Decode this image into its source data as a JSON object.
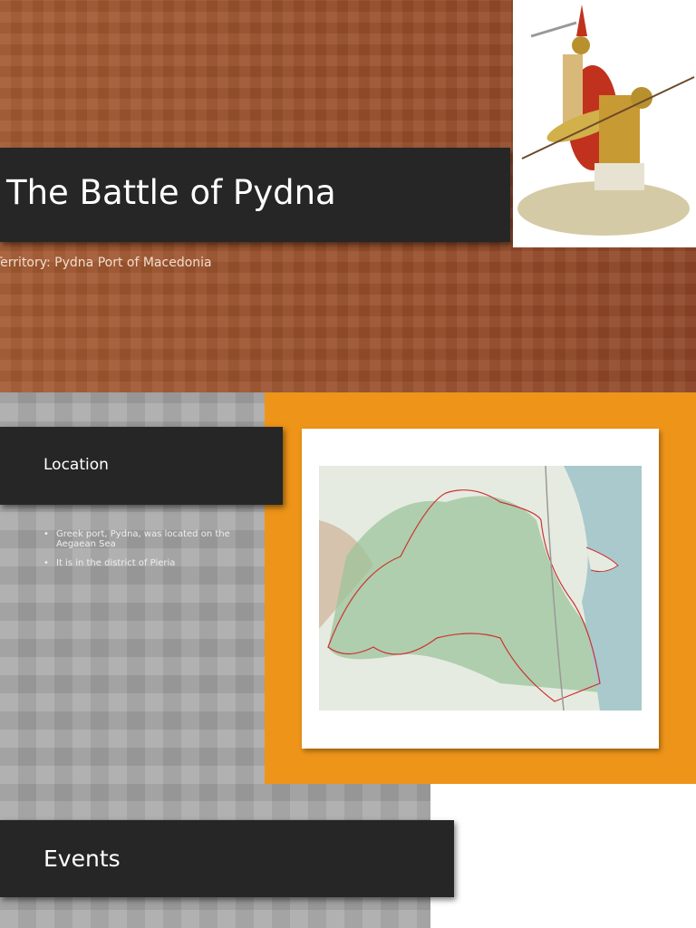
{
  "slide1": {
    "title": "The Battle of Pydna",
    "subtitle": "Territory: Pydna Port of Macedonia"
  },
  "slide2": {
    "heading": "Location",
    "bullets": [
      "Greek port, Pydna, was located on the Aegaean Sea",
      "It is in the district of Pieria"
    ]
  },
  "slide3": {
    "heading": "Events"
  },
  "colors": {
    "brown": "#9a4f2c",
    "dark_bar": "#262626",
    "orange": "#ee9419",
    "gray": "#a7a7a7"
  }
}
